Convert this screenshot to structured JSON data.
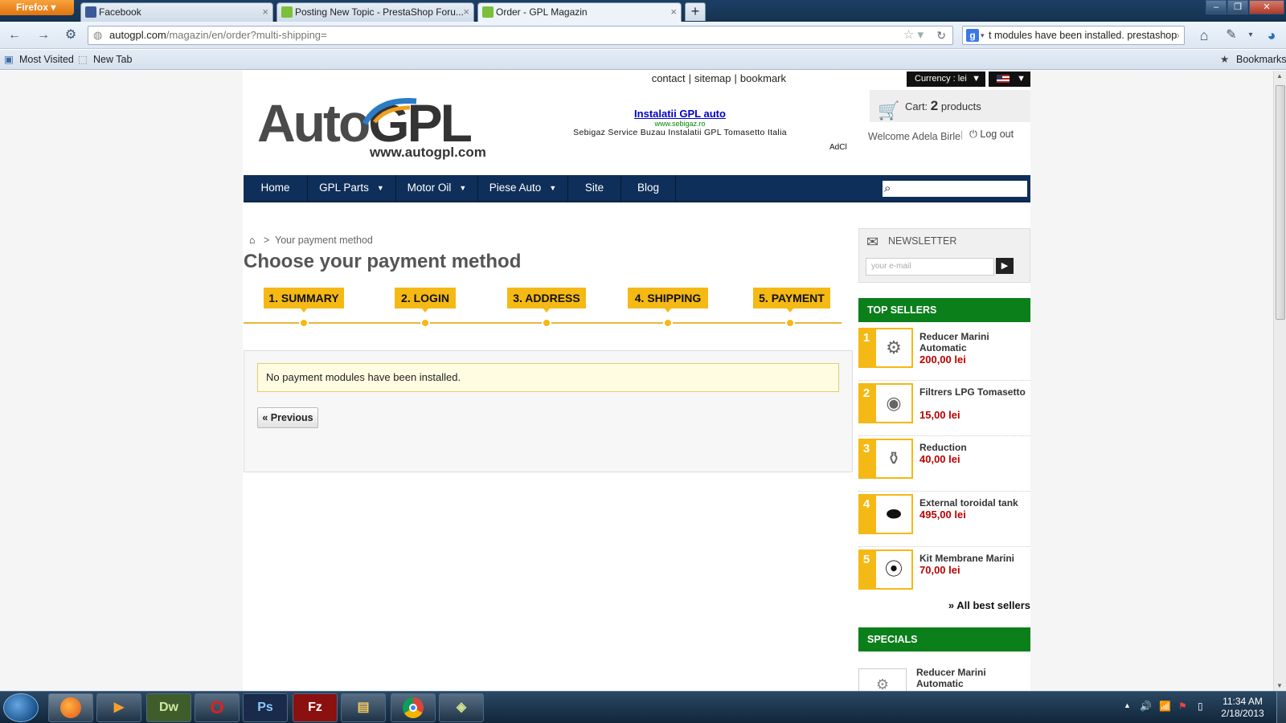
{
  "browser": {
    "firefox_label": "Firefox",
    "tabs": [
      {
        "title": "Facebook",
        "icon": "facebook-icon",
        "color": "#3b5998"
      },
      {
        "title": "Posting New Topic - PrestaShop Foru...",
        "icon": "prestashop-icon",
        "color": "#7bbf3a"
      },
      {
        "title": "Order - GPL Magazin",
        "icon": "prestashop-icon",
        "color": "#7bbf3a"
      }
    ],
    "url_host": "autogpl.com",
    "url_path": "/magazin/en/order?multi-shipping=",
    "search_value": "t modules have been installed. prestashop",
    "bookmarks": [
      "Most Visited",
      "New Tab"
    ],
    "bookmarks_menu": "Bookmarks"
  },
  "site": {
    "top_links": [
      "contact",
      "sitemap",
      "bookmark"
    ],
    "currency_label": "Currency : lei",
    "logo_text_1": "Auto",
    "logo_text_2": "GPL",
    "logo_url": "www.autogpl.com",
    "ad": {
      "title": "Instalatii GPL auto",
      "url": "www.sebigaz.ro",
      "desc": "Sebigaz Service Buzau Instalatii GPL Tomasetto Italia",
      "choice": "AdCl"
    },
    "cart": {
      "label": "Cart:",
      "count": "2",
      "unit": "products"
    },
    "welcome": "Welcome Adela Birle",
    "logout": "Log out",
    "menu": [
      "Home",
      "GPL Parts",
      "Motor Oil",
      "Piese Auto",
      "Site",
      "Blog"
    ],
    "breadcrumb": "Your payment method",
    "page_title": "Choose your payment method",
    "steps": [
      "1. SUMMARY",
      "2. LOGIN",
      "3. ADDRESS",
      "4. SHIPPING",
      "5. PAYMENT"
    ],
    "warning": "No payment modules have been installed.",
    "previous": "« Previous",
    "newsletter": {
      "title": "NEWSLETTER",
      "placeholder": "your e-mail"
    },
    "top_sellers": {
      "title": "TOP SELLERS",
      "items": [
        {
          "rank": "1",
          "name": "Reducer Marini Automatic",
          "price": "200,00 lei"
        },
        {
          "rank": "2",
          "name": "Filtrers LPG Tomasetto",
          "price": "15,00 lei"
        },
        {
          "rank": "3",
          "name": "Reduction",
          "price": "40,00 lei"
        },
        {
          "rank": "4",
          "name": "External toroidal tank",
          "price": "495,00 lei"
        },
        {
          "rank": "5",
          "name": "Kit Membrane Marini",
          "price": "70,00 lei"
        }
      ],
      "all_link": "» All best sellers"
    },
    "specials": {
      "title": "SPECIALS",
      "item_name": "Reducer Marini Automatic"
    }
  },
  "taskbar": {
    "apps": [
      "Firefox",
      "Media",
      "Dw",
      "O",
      "Ps",
      "Fz",
      "Explorer",
      "Chrome",
      "Folder"
    ],
    "time": "11:34 AM",
    "date": "2/18/2013"
  }
}
